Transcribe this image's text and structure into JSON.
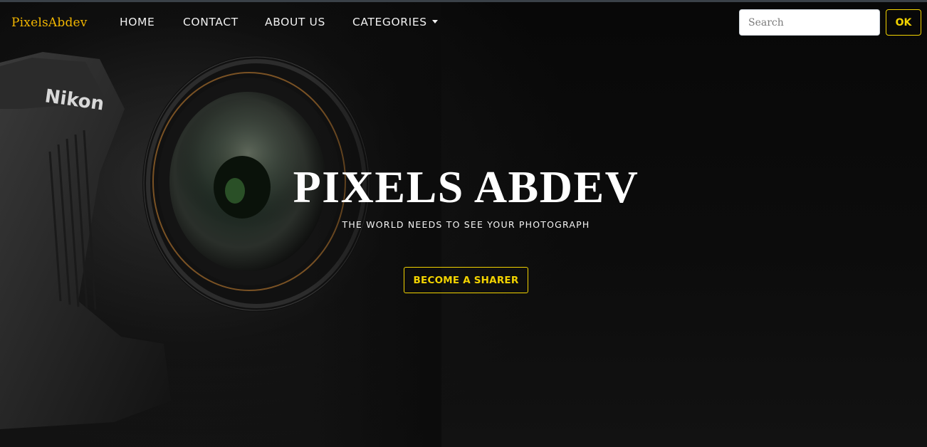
{
  "brand": "PixelsAbdev",
  "nav": {
    "home": "HOME",
    "contact": "CONTACT",
    "about": "ABOUT US",
    "categories": "CATEGORIES"
  },
  "search": {
    "placeholder": "Search",
    "value": "",
    "button_label": "OK"
  },
  "hero": {
    "title": "PIXELS ABDEV",
    "subtitle": "THE WORLD NEEDS TO SEE YOUR PHOTOGRAPH",
    "cta_label": "BECOME A SHARER",
    "camera_brand": "Nikon"
  },
  "colors": {
    "accent_yellow": "#f2d300",
    "brand_gold": "#f2b600",
    "background": "#0b0b0b"
  }
}
